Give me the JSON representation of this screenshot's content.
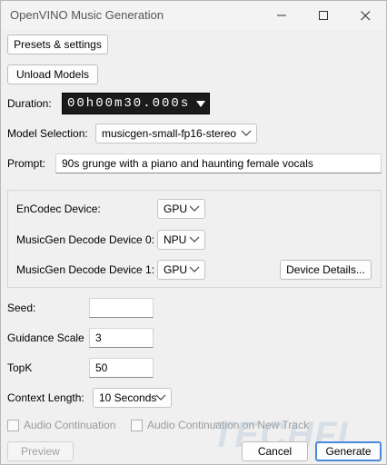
{
  "window": {
    "title": "OpenVINO Music Generation"
  },
  "buttons": {
    "presets": "Presets & settings",
    "unload": "Unload Models",
    "device_details": "Device Details...",
    "preview": "Preview",
    "cancel": "Cancel",
    "generate": "Generate"
  },
  "duration": {
    "label": "Duration:",
    "value": "00h00m30.000s"
  },
  "model": {
    "label": "Model Selection:",
    "value": "musicgen-small-fp16-stereo"
  },
  "prompt": {
    "label": "Prompt:",
    "value": "90s grunge with a piano and haunting female vocals"
  },
  "devices": {
    "encodec_label": "EnCodec Device:",
    "encodec_value": "GPU",
    "decode0_label": "MusicGen Decode Device 0:",
    "decode0_value": "NPU",
    "decode1_label": "MusicGen Decode Device 1:",
    "decode1_value": "GPU"
  },
  "seed": {
    "label": "Seed:",
    "value": ""
  },
  "guidance": {
    "label": "Guidance Scale",
    "value": "3"
  },
  "topk": {
    "label": "TopK",
    "value": "50"
  },
  "context": {
    "label": "Context Length:",
    "value": "10 Seconds"
  },
  "checkboxes": {
    "audio_continuation": "Audio Continuation",
    "audio_continuation_new_track": "Audio Continuation on New Track"
  },
  "watermark": "TECHFI",
  "colors": {
    "primary_border": "#4a89dc",
    "duration_bg": "#1b1b1b"
  }
}
